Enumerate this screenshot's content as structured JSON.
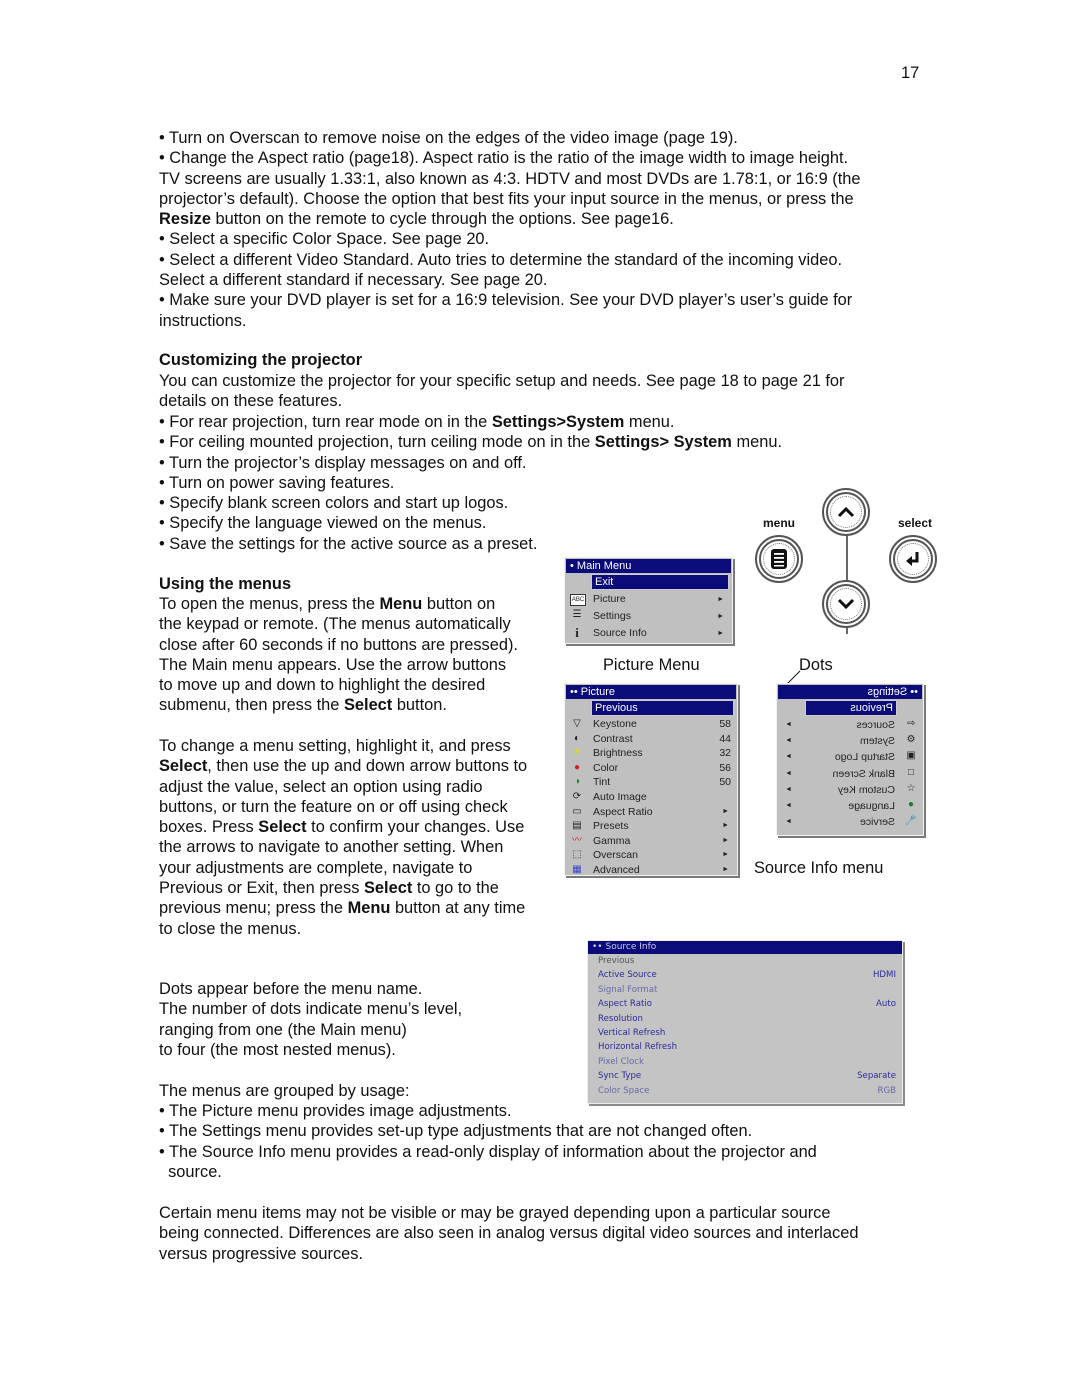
{
  "page_number": "17",
  "intro_bullets": [
    {
      "parts": [
        {
          "t": "• Turn on Overscan to remove noise on the edges of the video image (page 19)."
        }
      ]
    },
    {
      "lines": [
        [
          {
            "t": "• Change the Aspect ratio (page18). Aspect ratio is the ratio of the image width to image height."
          }
        ],
        [
          {
            "t": "TV screens are usually 1.33:1, also known as 4:3. HDTV and most DVDs are 1.78:1, or 16:9 (the"
          }
        ],
        [
          {
            "t": "projector’s default). Choose the option that best fits your input source in the menus, or press the"
          }
        ],
        [
          {
            "t": "Resize",
            "b": true
          },
          {
            "t": " button on the remote to cycle through the options. See page16."
          }
        ]
      ]
    },
    {
      "parts": [
        {
          "t": "• Select a specific Color Space. See page 20."
        }
      ]
    },
    {
      "lines": [
        [
          {
            "t": "• Select a different Video Standard. Auto tries to determine the standard of the incoming video."
          }
        ],
        [
          {
            "t": "Select a different standard if necessary. See page 20."
          }
        ]
      ]
    },
    {
      "lines": [
        [
          {
            "t": "• Make sure your DVD player is set for a 16:9 television. See your DVD player’s user’s guide for"
          }
        ],
        [
          {
            "t": "instructions."
          }
        ]
      ]
    }
  ],
  "customizing": {
    "heading": "Customizing the projector",
    "intro_line1": "You can customize the projector for your specific setup and needs. See page 18 to page 21 for",
    "intro_line2": "details on these features.",
    "bullets": [
      [
        {
          "t": "• For rear projection, turn rear mode on in the "
        },
        {
          "t": "Settings>System",
          "b": true
        },
        {
          "t": " menu."
        }
      ],
      [
        {
          "t": "• For ceiling mounted projection, turn ceiling mode on in the "
        },
        {
          "t": "Settings> System",
          "b": true
        },
        {
          "t": " menu."
        }
      ],
      [
        {
          "t": "• Turn the projector’s display messages on and off."
        }
      ],
      [
        {
          "t": "• Turn on power saving features."
        }
      ],
      [
        {
          "t": "• Specify blank screen colors and start up logos."
        }
      ],
      [
        {
          "t": "• Specify the language viewed on the menus."
        }
      ],
      [
        {
          "t": "• Save the settings for the active source as a preset."
        }
      ]
    ]
  },
  "using_menus": {
    "heading": "Using the menus",
    "para1": [
      [
        {
          "t": "To open the menus, press the "
        },
        {
          "t": "Menu",
          "b": true
        },
        {
          "t": " button on"
        }
      ],
      [
        {
          "t": "the keypad or remote. (The menus automatically"
        }
      ],
      [
        {
          "t": "close after 60 seconds if no buttons are pressed)."
        }
      ],
      [
        {
          "t": "The Main menu appears. Use the arrow buttons"
        }
      ],
      [
        {
          "t": "to move up and down to highlight the desired"
        }
      ],
      [
        {
          "t": "submenu, then press the "
        },
        {
          "t": "Select",
          "b": true
        },
        {
          "t": " button."
        }
      ]
    ],
    "para2": [
      [
        {
          "t": "To change a menu setting, highlight it, and press"
        }
      ],
      [
        {
          "t": "Select",
          "b": true
        },
        {
          "t": ", then use the up and down arrow buttons to"
        }
      ],
      [
        {
          "t": "adjust the value, select an option using radio"
        }
      ],
      [
        {
          "t": "buttons, or turn the feature on or off using check"
        }
      ],
      [
        {
          "t": "boxes. Press "
        },
        {
          "t": "Select",
          "b": true
        },
        {
          "t": " to confirm your changes. Use"
        }
      ],
      [
        {
          "t": "the arrows to navigate to another setting. When"
        }
      ],
      [
        {
          "t": "your adjustments are complete, navigate to"
        }
      ],
      [
        {
          "t": "Previous or Exit, then press "
        },
        {
          "t": "Select",
          "b": true
        },
        {
          "t": " to go to the"
        }
      ],
      [
        {
          "t": "previous menu; press the "
        },
        {
          "t": "Menu",
          "b": true
        },
        {
          "t": " button at any time"
        }
      ],
      [
        {
          "t": "to close the menus."
        }
      ]
    ],
    "dots_para": [
      "Dots appear before the menu name.",
      "The number of dots indicate menu’s level,",
      "ranging from one (the Main menu)",
      "to four (the most nested menus)."
    ],
    "grouped_intro": "The menus are grouped by usage:",
    "grouped_bullets": [
      "• The Picture menu provides image adjustments.",
      "• The Settings menu provides set-up type adjustments that are not changed often.",
      "• The Source Info menu provides a read-only display of information about the projector and",
      "  source."
    ],
    "closing": [
      "Certain menu items may not be visible or may be grayed depending upon a particular source",
      "being connected. Differences are also seen in analog versus digital video sources and interlaced",
      "versus progressive sources."
    ]
  },
  "keypad": {
    "menu_label": "menu",
    "select_label": "select",
    "icons": {
      "menu": "menu-list-icon",
      "select": "enter-return-icon",
      "up": "chevron-up-icon",
      "down": "chevron-down-icon"
    }
  },
  "main_menu": {
    "title": "• Main Menu",
    "highlighted": "Exit",
    "items": [
      {
        "label": "Picture",
        "icon": "abc-picture-icon",
        "glyph": "ABC",
        "arrow": "►"
      },
      {
        "label": "Settings",
        "icon": "settings-icon",
        "glyph": "☰",
        "arrow": "►"
      },
      {
        "label": "Source Info",
        "icon": "info-icon",
        "glyph": "i",
        "arrow": "►"
      }
    ]
  },
  "captions": {
    "picture_menu": "Picture Menu",
    "dots": "Dots",
    "source_info_menu": "Source Info menu"
  },
  "picture_menu": {
    "title": "•• Picture",
    "highlighted": "Previous",
    "items": [
      {
        "label": "Keystone",
        "value": "58",
        "icon": "keystone-icon",
        "glyph": "▽"
      },
      {
        "label": "Contrast",
        "value": "44",
        "icon": "contrast-icon",
        "glyph": "◐"
      },
      {
        "label": "Brightness",
        "value": "32",
        "icon": "brightness-icon",
        "glyph": "☀"
      },
      {
        "label": "Color",
        "value": "56",
        "icon": "color-icon",
        "glyph": "●"
      },
      {
        "label": "Tint",
        "value": "50",
        "icon": "tint-icon",
        "glyph": "◑"
      },
      {
        "label": "Auto Image",
        "value": "",
        "icon": "auto-image-icon",
        "glyph": "⟳"
      },
      {
        "label": "Aspect Ratio",
        "arrow": "►",
        "icon": "aspect-ratio-icon",
        "glyph": "▭"
      },
      {
        "label": "Presets",
        "arrow": "►",
        "icon": "presets-icon",
        "glyph": "▤"
      },
      {
        "label": "Gamma",
        "arrow": "►",
        "icon": "gamma-icon",
        "glyph": "〰"
      },
      {
        "label": "Overscan",
        "arrow": "►",
        "icon": "overscan-icon",
        "glyph": "⬚"
      },
      {
        "label": "Advanced",
        "arrow": "►",
        "icon": "advanced-icon",
        "glyph": "▦"
      }
    ],
    "colors": {
      "brightness": "#e6d800",
      "color_red": "#cc2222",
      "tint_green": "#1a8a1a"
    }
  },
  "settings_menu": {
    "title": "•• Settings",
    "highlighted": "Previous",
    "mirrored": true,
    "items": [
      {
        "label": "Sources",
        "icon": "sources-icon",
        "glyph": "⇦",
        "arrow": "◄"
      },
      {
        "label": "System",
        "icon": "system-icon",
        "glyph": "⚙",
        "arrow": "◄"
      },
      {
        "label": "Startup Logo",
        "icon": "startup-logo-icon",
        "glyph": "▣",
        "arrow": "◄"
      },
      {
        "label": "Blank Screen",
        "icon": "blank-screen-icon",
        "glyph": "□",
        "arrow": "◄"
      },
      {
        "label": "Custom Key",
        "icon": "star-icon",
        "glyph": "☆",
        "arrow": "◄"
      },
      {
        "label": "Language",
        "icon": "globe-icon",
        "glyph": "●",
        "arrow": "◄"
      },
      {
        "label": "Service",
        "icon": "wrench-icon",
        "glyph": "🔧",
        "arrow": "◄"
      }
    ]
  },
  "source_info_menu": {
    "title": "••  Source Info",
    "items": [
      {
        "label": "Previous",
        "value": "",
        "style": "prev"
      },
      {
        "label": "Active Source",
        "value": "HDMI",
        "style": ""
      },
      {
        "label": "Signal Format",
        "value": "",
        "style": "dim"
      },
      {
        "label": "Aspect Ratio",
        "value": "Auto",
        "style": ""
      },
      {
        "label": "Resolution",
        "value": "",
        "style": ""
      },
      {
        "label": "Vertical Refresh",
        "value": "",
        "style": ""
      },
      {
        "label": "Horizontal Refresh",
        "value": "",
        "style": ""
      },
      {
        "label": "Pixel Clock",
        "value": "",
        "style": "dim"
      },
      {
        "label": "Sync Type",
        "value": "Separate",
        "style": ""
      },
      {
        "label": "Color Space",
        "value": "RGB",
        "style": "dim"
      }
    ]
  },
  "colors": {
    "menu_title_bg": "#0b0b7a",
    "menu_bg": "#c0c0c0",
    "source_text": "#2b2b9a"
  }
}
